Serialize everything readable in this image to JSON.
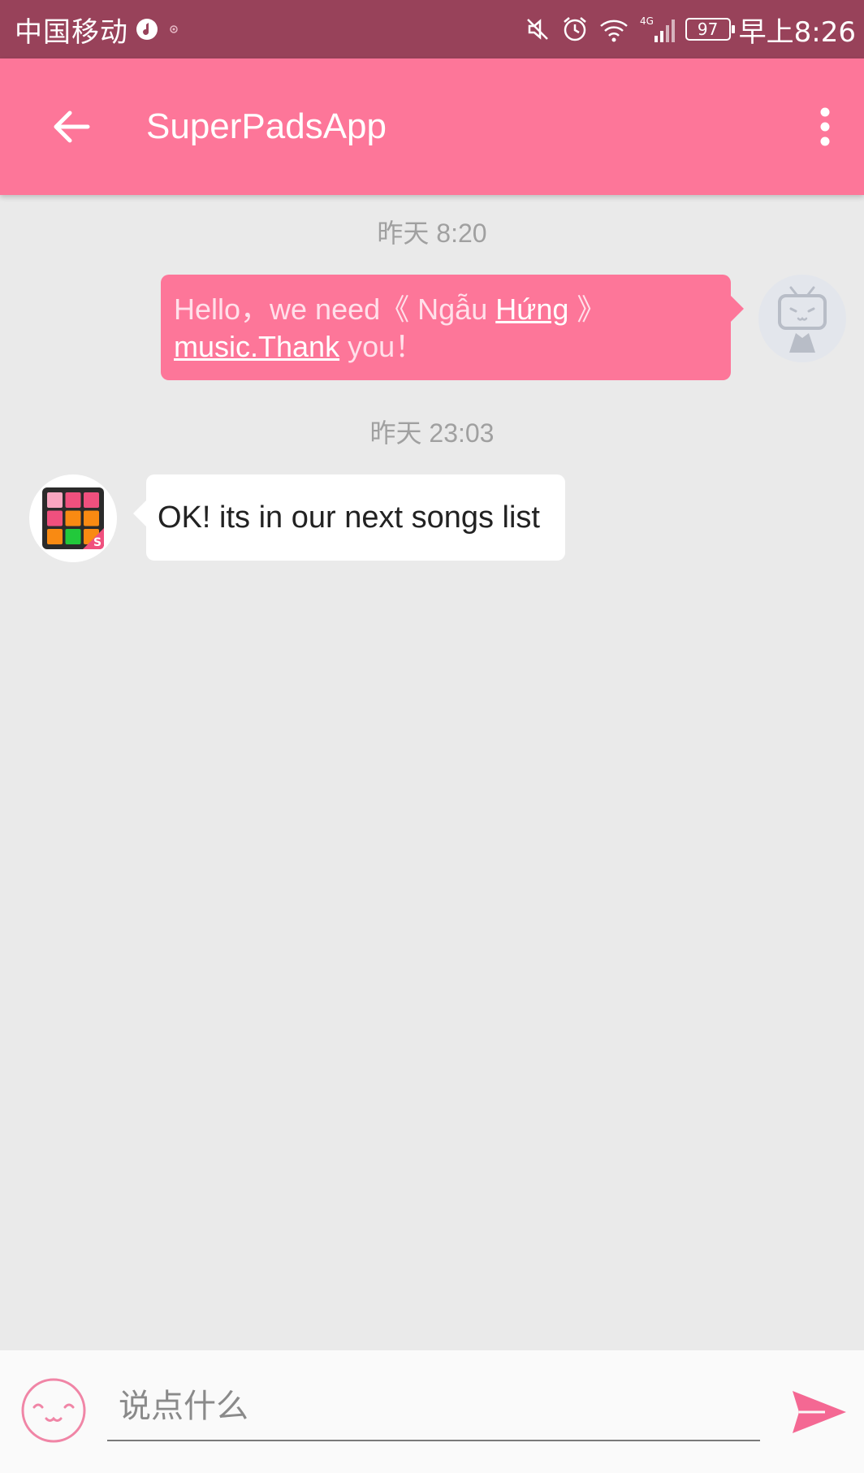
{
  "status_bar": {
    "carrier": "中国移动",
    "network": "4G",
    "battery": "97",
    "time": "早上8:26"
  },
  "app_bar": {
    "title": "SuperPadsApp"
  },
  "messages": [
    {
      "timestamp": "昨天 8:20",
      "sender": "me",
      "text_parts": [
        "Hello，we need《 Ngẫu ",
        "Hứng",
        " 》",
        "music.Thank",
        " you！"
      ]
    },
    {
      "timestamp": "昨天 23:03",
      "sender": "app",
      "text": "OK! its in our next songs list"
    }
  ],
  "input": {
    "placeholder": "说点什么"
  },
  "colors": {
    "status_bar": "#98425A",
    "app_bar": "#FD7699",
    "chat_background": "#EAEAEA",
    "accent": "#FD7699"
  }
}
